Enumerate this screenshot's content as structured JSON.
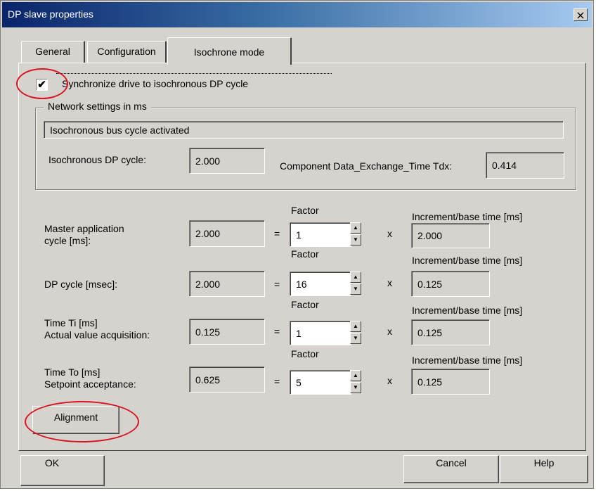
{
  "window": {
    "title": "DP slave properties",
    "close_icon": "×"
  },
  "tabs": [
    {
      "label": "General"
    },
    {
      "label": "Configuration"
    },
    {
      "label": "Isochrone mode",
      "active": true
    }
  ],
  "sync": {
    "checked": true,
    "check_glyph": "✔",
    "label": "Synchronize drive to isochronous DP cycle"
  },
  "network": {
    "legend": "Network settings in ms",
    "status": "Isochronous bus cycle activated",
    "dp_cycle_label": "Isochronous DP cycle:",
    "dp_cycle_value": "2.000",
    "tdx_label": "Component Data_Exchange_Time Tdx:",
    "tdx_value": "0.414"
  },
  "rows": [
    {
      "label_line1": "Master application",
      "label_line2": "cycle [ms]:",
      "value": "2.000",
      "factor_label": "Factor",
      "factor": "1",
      "increment_label": "Increment/base time [ms]",
      "increment": "2.000"
    },
    {
      "label_line1": "DP cycle  [msec]:",
      "label_line2": "",
      "value": "2.000",
      "factor_label": "Factor",
      "factor": "16",
      "increment_label": "Increment/base time [ms]",
      "increment": "0.125"
    },
    {
      "label_line1": "Time Ti [ms]",
      "label_line2": "Actual value acquisition:",
      "value": "0.125",
      "factor_label": "Factor",
      "factor": "1",
      "increment_label": "Increment/base time [ms]",
      "increment": "0.125"
    },
    {
      "label_line1": "Time To [ms]",
      "label_line2": "Setpoint acceptance:",
      "value": "0.625",
      "factor_label": "Factor",
      "factor": "5",
      "increment_label": "Increment/base time [ms]",
      "increment": "0.125"
    }
  ],
  "operators": {
    "equals": "=",
    "times": "x"
  },
  "spinner": {
    "up_icon": "▲",
    "down_icon": "▼"
  },
  "buttons": {
    "alignment": "Alignment",
    "ok": "OK",
    "cancel": "Cancel",
    "help": "Help"
  },
  "colors": {
    "annotation": "#d8141e",
    "face": "#d6d3ce",
    "title_start": "#0a246a",
    "title_end": "#a6caf0"
  }
}
